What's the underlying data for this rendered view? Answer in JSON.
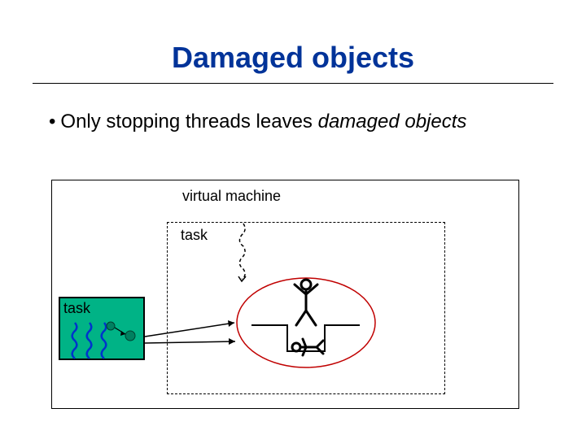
{
  "title": "Damaged objects",
  "bullet": {
    "prefix": "Only stopping threads leaves ",
    "italic": "damaged objects"
  },
  "vm": {
    "label": "virtual machine",
    "task_label": "task"
  }
}
